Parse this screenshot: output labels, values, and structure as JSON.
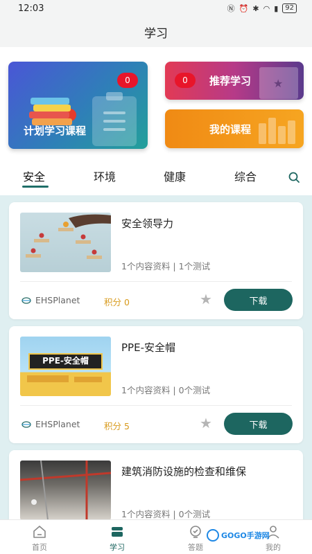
{
  "status_bar": {
    "time": "12:03",
    "battery": "92"
  },
  "header": {
    "title": "学习"
  },
  "feature_cards": {
    "plan": {
      "label": "计划学习课程",
      "badge": "0"
    },
    "recommend": {
      "label": "推荐学习",
      "badge": "0"
    },
    "my_courses": {
      "label": "我的课程"
    }
  },
  "tabs": [
    "安全",
    "环境",
    "健康",
    "综合"
  ],
  "active_tab": "安全",
  "courses": [
    {
      "title": "安全领导力",
      "meta": "1个内容资料 | 1个测试",
      "provider": "EHSPlanet",
      "points": "积分 0",
      "download": "下载"
    },
    {
      "title": "PPE-安全帽",
      "thumb_text": "PPE-安全帽",
      "meta": "1个内容资料 | 0个测试",
      "provider": "EHSPlanet",
      "points": "积分 5",
      "download": "下载"
    },
    {
      "title": "建筑消防设施的检查和维保",
      "meta": "1个内容资料 | 0个测试"
    }
  ],
  "bottom_nav": [
    {
      "label": "首页",
      "icon": "home-icon"
    },
    {
      "label": "学习",
      "icon": "book-icon"
    },
    {
      "label": "答题",
      "icon": "quiz-icon"
    },
    {
      "label": "我的",
      "icon": "user-icon"
    }
  ],
  "watermark": "GOGO手游网",
  "colors": {
    "primary": "#1d6660",
    "badge": "#e8152a",
    "points": "#d89a1c"
  }
}
